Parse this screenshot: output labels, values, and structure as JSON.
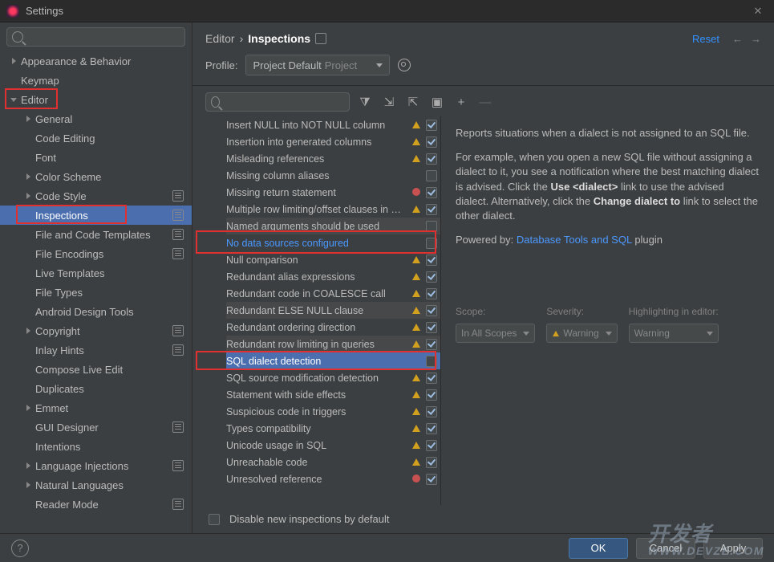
{
  "title": "Settings",
  "breadcrumb": {
    "a": "Editor",
    "b": "Inspections"
  },
  "reset": "Reset",
  "profile": {
    "label": "Profile:",
    "value": "Project Default",
    "hint": "Project"
  },
  "sidebar": [
    {
      "label": "Appearance & Behavior",
      "depth": 0,
      "arrow": "col"
    },
    {
      "label": "Keymap",
      "depth": 0,
      "arrow": "none"
    },
    {
      "label": "Editor",
      "depth": 0,
      "arrow": "exp",
      "hl": "editor"
    },
    {
      "label": "General",
      "depth": 1,
      "arrow": "col"
    },
    {
      "label": "Code Editing",
      "depth": 1,
      "arrow": "none"
    },
    {
      "label": "Font",
      "depth": 1,
      "arrow": "none"
    },
    {
      "label": "Color Scheme",
      "depth": 1,
      "arrow": "col"
    },
    {
      "label": "Code Style",
      "depth": 1,
      "arrow": "col",
      "badge": true
    },
    {
      "label": "Inspections",
      "depth": 1,
      "arrow": "none",
      "sel": true,
      "badge": true,
      "hl": "inspections"
    },
    {
      "label": "File and Code Templates",
      "depth": 1,
      "arrow": "none",
      "badge": true
    },
    {
      "label": "File Encodings",
      "depth": 1,
      "arrow": "none",
      "badge": true
    },
    {
      "label": "Live Templates",
      "depth": 1,
      "arrow": "none"
    },
    {
      "label": "File Types",
      "depth": 1,
      "arrow": "none"
    },
    {
      "label": "Android Design Tools",
      "depth": 1,
      "arrow": "none"
    },
    {
      "label": "Copyright",
      "depth": 1,
      "arrow": "col",
      "badge": true
    },
    {
      "label": "Inlay Hints",
      "depth": 1,
      "arrow": "none",
      "badge": true
    },
    {
      "label": "Compose Live Edit",
      "depth": 1,
      "arrow": "none"
    },
    {
      "label": "Duplicates",
      "depth": 1,
      "arrow": "none"
    },
    {
      "label": "Emmet",
      "depth": 1,
      "arrow": "col"
    },
    {
      "label": "GUI Designer",
      "depth": 1,
      "arrow": "none",
      "badge": true
    },
    {
      "label": "Intentions",
      "depth": 1,
      "arrow": "none"
    },
    {
      "label": "Language Injections",
      "depth": 1,
      "arrow": "col",
      "badge": true
    },
    {
      "label": "Natural Languages",
      "depth": 1,
      "arrow": "col"
    },
    {
      "label": "Reader Mode",
      "depth": 1,
      "arrow": "none",
      "badge": true
    }
  ],
  "inspections": [
    {
      "label": "Insert NULL into NOT NULL column",
      "sev": "warn",
      "chk": true
    },
    {
      "label": "Insertion into generated columns",
      "sev": "warn",
      "chk": true
    },
    {
      "label": "Misleading references",
      "sev": "warn",
      "chk": true
    },
    {
      "label": "Missing column aliases",
      "sev": "",
      "chk": false
    },
    {
      "label": "Missing return statement",
      "sev": "err",
      "chk": true
    },
    {
      "label": "Multiple row limiting/offset clauses in …",
      "sev": "warn",
      "chk": true
    },
    {
      "label": "Named arguments should be used",
      "sev": "",
      "chk": false,
      "seldim": true
    },
    {
      "label": "No data sources configured",
      "sev": "",
      "chk": false,
      "link": true,
      "hl": "nodatasrc"
    },
    {
      "label": "Null comparison",
      "sev": "warn",
      "chk": true
    },
    {
      "label": "Redundant alias expressions",
      "sev": "warn",
      "chk": true
    },
    {
      "label": "Redundant code in COALESCE call",
      "sev": "warn",
      "chk": true
    },
    {
      "label": "Redundant ELSE NULL clause",
      "sev": "warn",
      "chk": true,
      "seldim": true
    },
    {
      "label": "Redundant ordering direction",
      "sev": "warn",
      "chk": true
    },
    {
      "label": "Redundant row limiting in queries",
      "sev": "warn",
      "chk": true,
      "seldim": true
    },
    {
      "label": "SQL dialect detection",
      "sev": "",
      "chk": false,
      "sel": true,
      "hl": "sqldialect"
    },
    {
      "label": "SQL source modification detection",
      "sev": "warn",
      "chk": true
    },
    {
      "label": "Statement with side effects",
      "sev": "warn",
      "chk": true
    },
    {
      "label": "Suspicious code in triggers",
      "sev": "warn",
      "chk": true
    },
    {
      "label": "Types compatibility",
      "sev": "warn",
      "chk": true
    },
    {
      "label": "Unicode usage in SQL",
      "sev": "warn",
      "chk": true
    },
    {
      "label": "Unreachable code",
      "sev": "warn",
      "chk": true
    },
    {
      "label": "Unresolved reference",
      "sev": "err",
      "chk": true
    }
  ],
  "detail": {
    "p1": "Reports situations when a dialect is not assigned to an SQL file.",
    "p2a": "For example, when you open a new SQL file without assigning a dialect to it, you see a notification where the best matching dialect is advised. Click the ",
    "p2b": "Use <dialect>",
    "p2c": " link to use the advised dialect. Alternatively, click the ",
    "p2d": "Change dialect to",
    "p2e": " link to select the other dialect.",
    "powered": "Powered by: ",
    "plugin_link": "Database Tools and SQL",
    "plugin_tail": " plugin"
  },
  "opts": {
    "scope_l": "Scope:",
    "scope_v": "In All Scopes",
    "sev_l": "Severity:",
    "sev_v": "Warning",
    "hl_l": "Highlighting in editor:",
    "hl_v": "Warning"
  },
  "disable": "Disable new inspections by default",
  "buttons": {
    "ok": "OK",
    "cancel": "Cancel",
    "apply": "Apply"
  },
  "watermark": {
    "main": "开发者",
    "sub": "WWW.DEVZE.COM"
  }
}
